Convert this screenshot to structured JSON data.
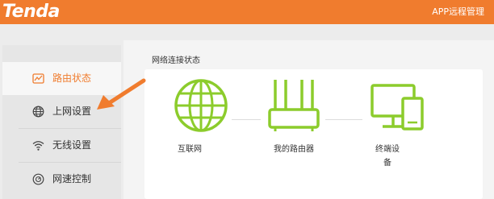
{
  "header": {
    "brand": "Tenda",
    "app_remote_label": "APP远程管理"
  },
  "sidebar": {
    "items": [
      {
        "label": "路由状态",
        "icon": "chart-icon",
        "active": true
      },
      {
        "label": "上网设置",
        "icon": "globe-icon",
        "active": false
      },
      {
        "label": "无线设置",
        "icon": "wifi-icon",
        "active": false
      },
      {
        "label": "网速控制",
        "icon": "speedometer-icon",
        "active": false
      }
    ]
  },
  "main": {
    "section_title": "网络连接状态",
    "nodes": [
      {
        "label": "互联网",
        "icon": "internet-globe-icon"
      },
      {
        "label": "我的路由器",
        "icon": "router-icon"
      },
      {
        "label_line1": "终端设",
        "label_line2": "备",
        "icon": "terminal-devices-icon"
      }
    ]
  },
  "colors": {
    "brand_orange": "#f07c2e",
    "icon_green": "#8ccc2c"
  }
}
